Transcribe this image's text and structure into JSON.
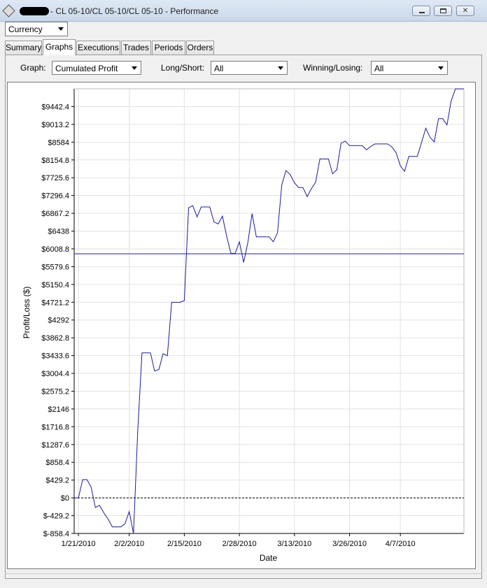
{
  "window": {
    "title": "- CL 05-10/CL 05-10/CL 05-10 - Performance",
    "minimize_glyph": "_",
    "restore_glyph": "□",
    "close_glyph": "✕"
  },
  "currency_select": {
    "value": "Currency"
  },
  "tabs": [
    {
      "label": "Summary"
    },
    {
      "label": "Graphs"
    },
    {
      "label": "Executions"
    },
    {
      "label": "Trades"
    },
    {
      "label": "Periods"
    },
    {
      "label": "Orders"
    }
  ],
  "active_tab": "Graphs",
  "filters": {
    "graph_label": "Graph:",
    "graph_value": "Cumulated Profit",
    "long_short_label": "Long/Short:",
    "long_short_value": "All",
    "winning_losing_label": "Winning/Losing:",
    "winning_losing_value": "All"
  },
  "colors": {
    "line": "#1c1c9a",
    "grid": "#e2e2e2",
    "axis": "#000000"
  },
  "chart_data": {
    "type": "line",
    "xlabel": "Date",
    "ylabel": "Profit/Loss ($)",
    "x_tick_labels": [
      "1/21/2010",
      "2/2/2010",
      "2/15/2010",
      "2/28/2010",
      "3/13/2010",
      "3/26/2010",
      "4/7/2010"
    ],
    "x_tick_dates": [
      "2010-01-21",
      "2010-02-02",
      "2010-02-15",
      "2010-02-28",
      "2010-03-13",
      "2010-03-26",
      "2010-04-07"
    ],
    "y_tick_labels": [
      "$9442.4",
      "$9013.2",
      "$8584",
      "$8154.8",
      "$7725.6",
      "$7296.4",
      "$6867.2",
      "$6438",
      "$6008.8",
      "$5579.6",
      "$5150.4",
      "$4721.2",
      "$4292",
      "$3862.8",
      "$3433.6",
      "$3004.4",
      "$2575.2",
      "$2146",
      "$1716.8",
      "$1287.6",
      "$858.4",
      "$429.2",
      "$0",
      "$-429.2",
      "$-858.4"
    ],
    "y_tick_values": [
      9442.4,
      9013.2,
      8584,
      8154.8,
      7725.6,
      7296.4,
      6867.2,
      6438,
      6008.8,
      5579.6,
      5150.4,
      4721.2,
      4292,
      3862.8,
      3433.6,
      3004.4,
      2575.2,
      2146,
      1716.8,
      1287.6,
      858.4,
      429.2,
      0,
      -429.2,
      -858.4
    ],
    "ylim": [
      -858.4,
      9871.6
    ],
    "xlim": [
      "2010-01-20",
      "2010-04-22"
    ],
    "grid": true,
    "reference_lines": [
      {
        "style": "solid",
        "y": 5890
      },
      {
        "style": "dashed",
        "y": 0
      }
    ],
    "series": [
      {
        "x": [
          "2010-01-20",
          "2010-01-21",
          "2010-01-22",
          "2010-01-23",
          "2010-01-24",
          "2010-01-25",
          "2010-01-26",
          "2010-01-27",
          "2010-01-28",
          "2010-01-29",
          "2010-01-30",
          "2010-01-31",
          "2010-02-01",
          "2010-02-02",
          "2010-02-03",
          "2010-02-04",
          "2010-02-05",
          "2010-02-06",
          "2010-02-07",
          "2010-02-08",
          "2010-02-09",
          "2010-02-10",
          "2010-02-11",
          "2010-02-12",
          "2010-02-13",
          "2010-02-14",
          "2010-02-15",
          "2010-02-16",
          "2010-02-17",
          "2010-02-18",
          "2010-02-19",
          "2010-02-20",
          "2010-02-21",
          "2010-02-22",
          "2010-02-23",
          "2010-02-24",
          "2010-02-25",
          "2010-02-26",
          "2010-02-27",
          "2010-02-28",
          "2010-03-01",
          "2010-03-02",
          "2010-03-03",
          "2010-03-04",
          "2010-03-05",
          "2010-03-06",
          "2010-03-07",
          "2010-03-08",
          "2010-03-09",
          "2010-03-10",
          "2010-03-11",
          "2010-03-12",
          "2010-03-13",
          "2010-03-14",
          "2010-03-15",
          "2010-03-16",
          "2010-03-17",
          "2010-03-18",
          "2010-03-19",
          "2010-03-20",
          "2010-03-21",
          "2010-03-22",
          "2010-03-23",
          "2010-03-24",
          "2010-03-25",
          "2010-03-26",
          "2010-03-27",
          "2010-03-28",
          "2010-03-29",
          "2010-03-30",
          "2010-03-31",
          "2010-04-01",
          "2010-04-02",
          "2010-04-03",
          "2010-04-04",
          "2010-04-05",
          "2010-04-06",
          "2010-04-07",
          "2010-04-08",
          "2010-04-09",
          "2010-04-10",
          "2010-04-11",
          "2010-04-12",
          "2010-04-13",
          "2010-04-14",
          "2010-04-15",
          "2010-04-16",
          "2010-04-17",
          "2010-04-18",
          "2010-04-19",
          "2010-04-20",
          "2010-04-21",
          "2010-04-22"
        ],
        "y": [
          0,
          0,
          440,
          440,
          260,
          -230,
          -180,
          -360,
          -510,
          -700,
          -700,
          -700,
          -620,
          -330,
          -858.4,
          1600,
          3500,
          3500,
          3500,
          3060,
          3100,
          3480,
          3430,
          4720,
          4720,
          4720,
          4760,
          7000,
          7050,
          6780,
          7020,
          7020,
          7020,
          6660,
          6610,
          6800,
          6310,
          5900,
          5900,
          6180,
          5680,
          6160,
          6860,
          6300,
          6300,
          6300,
          6300,
          6180,
          6400,
          7550,
          7900,
          7800,
          7600,
          7490,
          7490,
          7270,
          7460,
          7620,
          8180,
          8180,
          8180,
          7820,
          7920,
          8560,
          8610,
          8500,
          8500,
          8500,
          8500,
          8400,
          8480,
          8540,
          8540,
          8540,
          8540,
          8470,
          8330,
          8010,
          7880,
          8240,
          8240,
          8240,
          8580,
          8920,
          8700,
          8590,
          9150,
          9150,
          9000,
          9580,
          9870,
          9870,
          9870
        ]
      }
    ]
  }
}
